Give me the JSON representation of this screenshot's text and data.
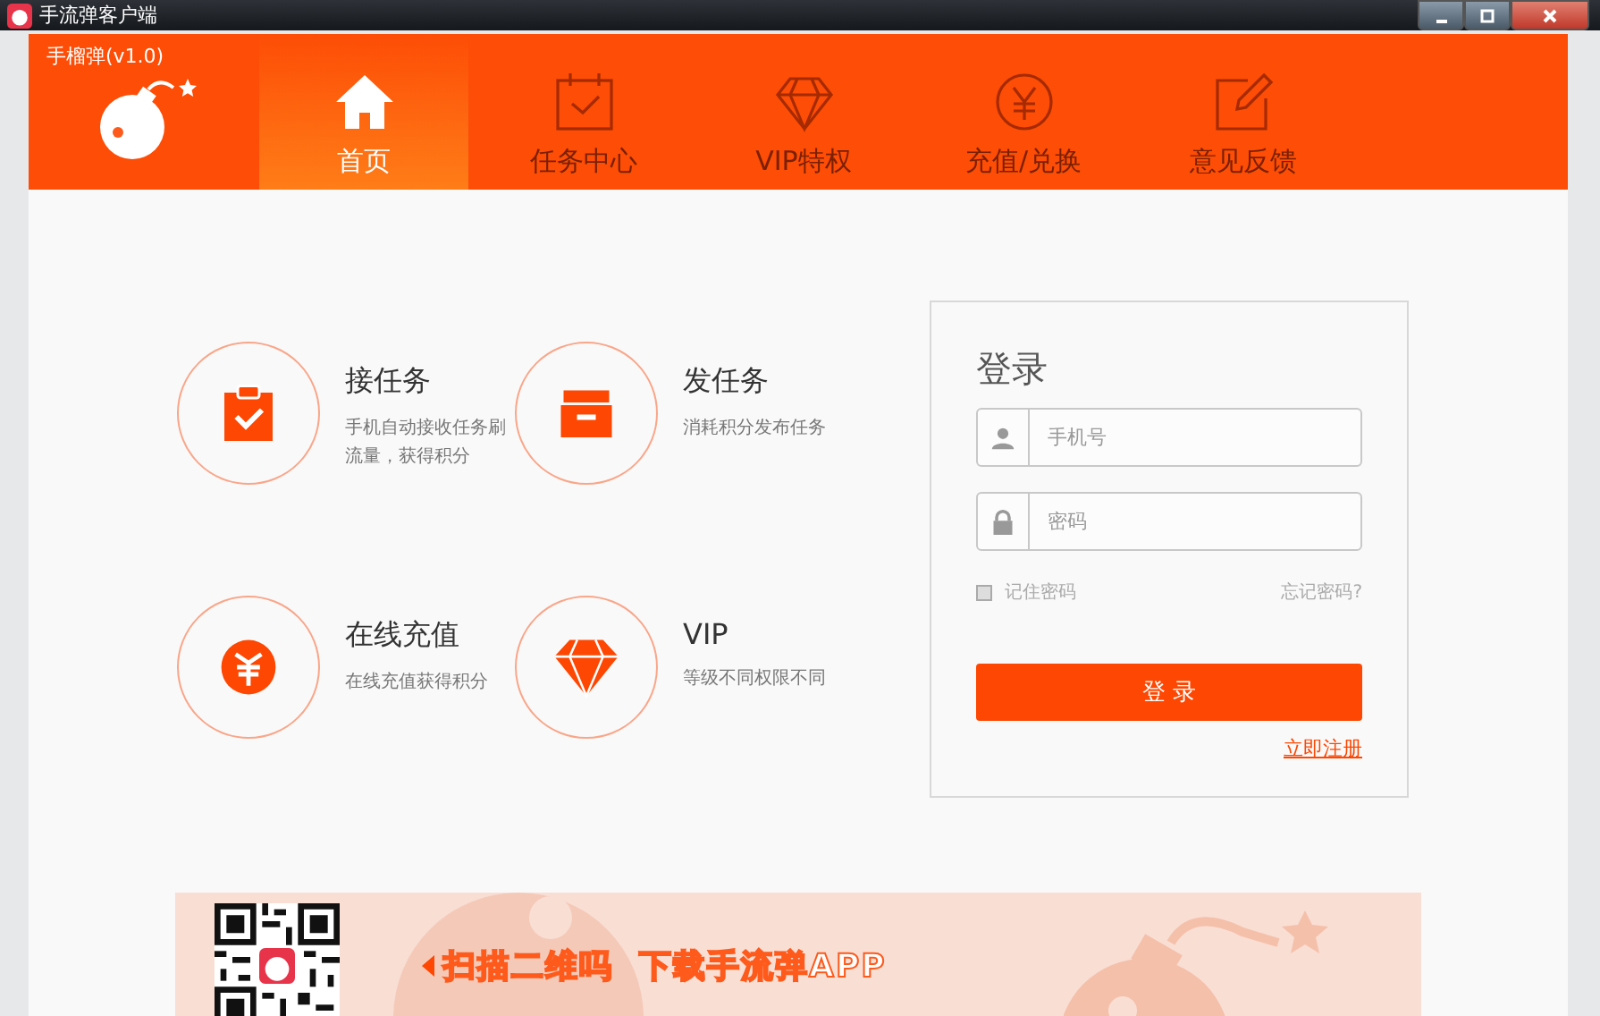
{
  "window": {
    "title": "手流弹客户端"
  },
  "header": {
    "app_name": "手榴弹(v1.0)",
    "tabs": [
      {
        "label": "首页",
        "selected": true
      },
      {
        "label": "任务中心",
        "selected": false
      },
      {
        "label": "VIP特权",
        "selected": false
      },
      {
        "label": "充值/兑换",
        "selected": false
      },
      {
        "label": "意见反馈",
        "selected": false
      }
    ]
  },
  "features": [
    {
      "title": "接任务",
      "description": "手机自动接收任务刷流量，获得积分"
    },
    {
      "title": "发任务",
      "description": "消耗积分发布任务"
    },
    {
      "title": "在线充值",
      "description": "在线充值获得积分"
    },
    {
      "title": "VIP",
      "description": "等级不同权限不同"
    }
  ],
  "login": {
    "title": "登录",
    "phone_placeholder": "手机号",
    "password_placeholder": "密码",
    "remember": {
      "label": "记住密码",
      "checked": false
    },
    "forgot": "忘记密码?",
    "submit": "登 录",
    "register": "立即注册"
  },
  "banner": {
    "text": "扫描二维吗  下载手流弹APP"
  }
}
